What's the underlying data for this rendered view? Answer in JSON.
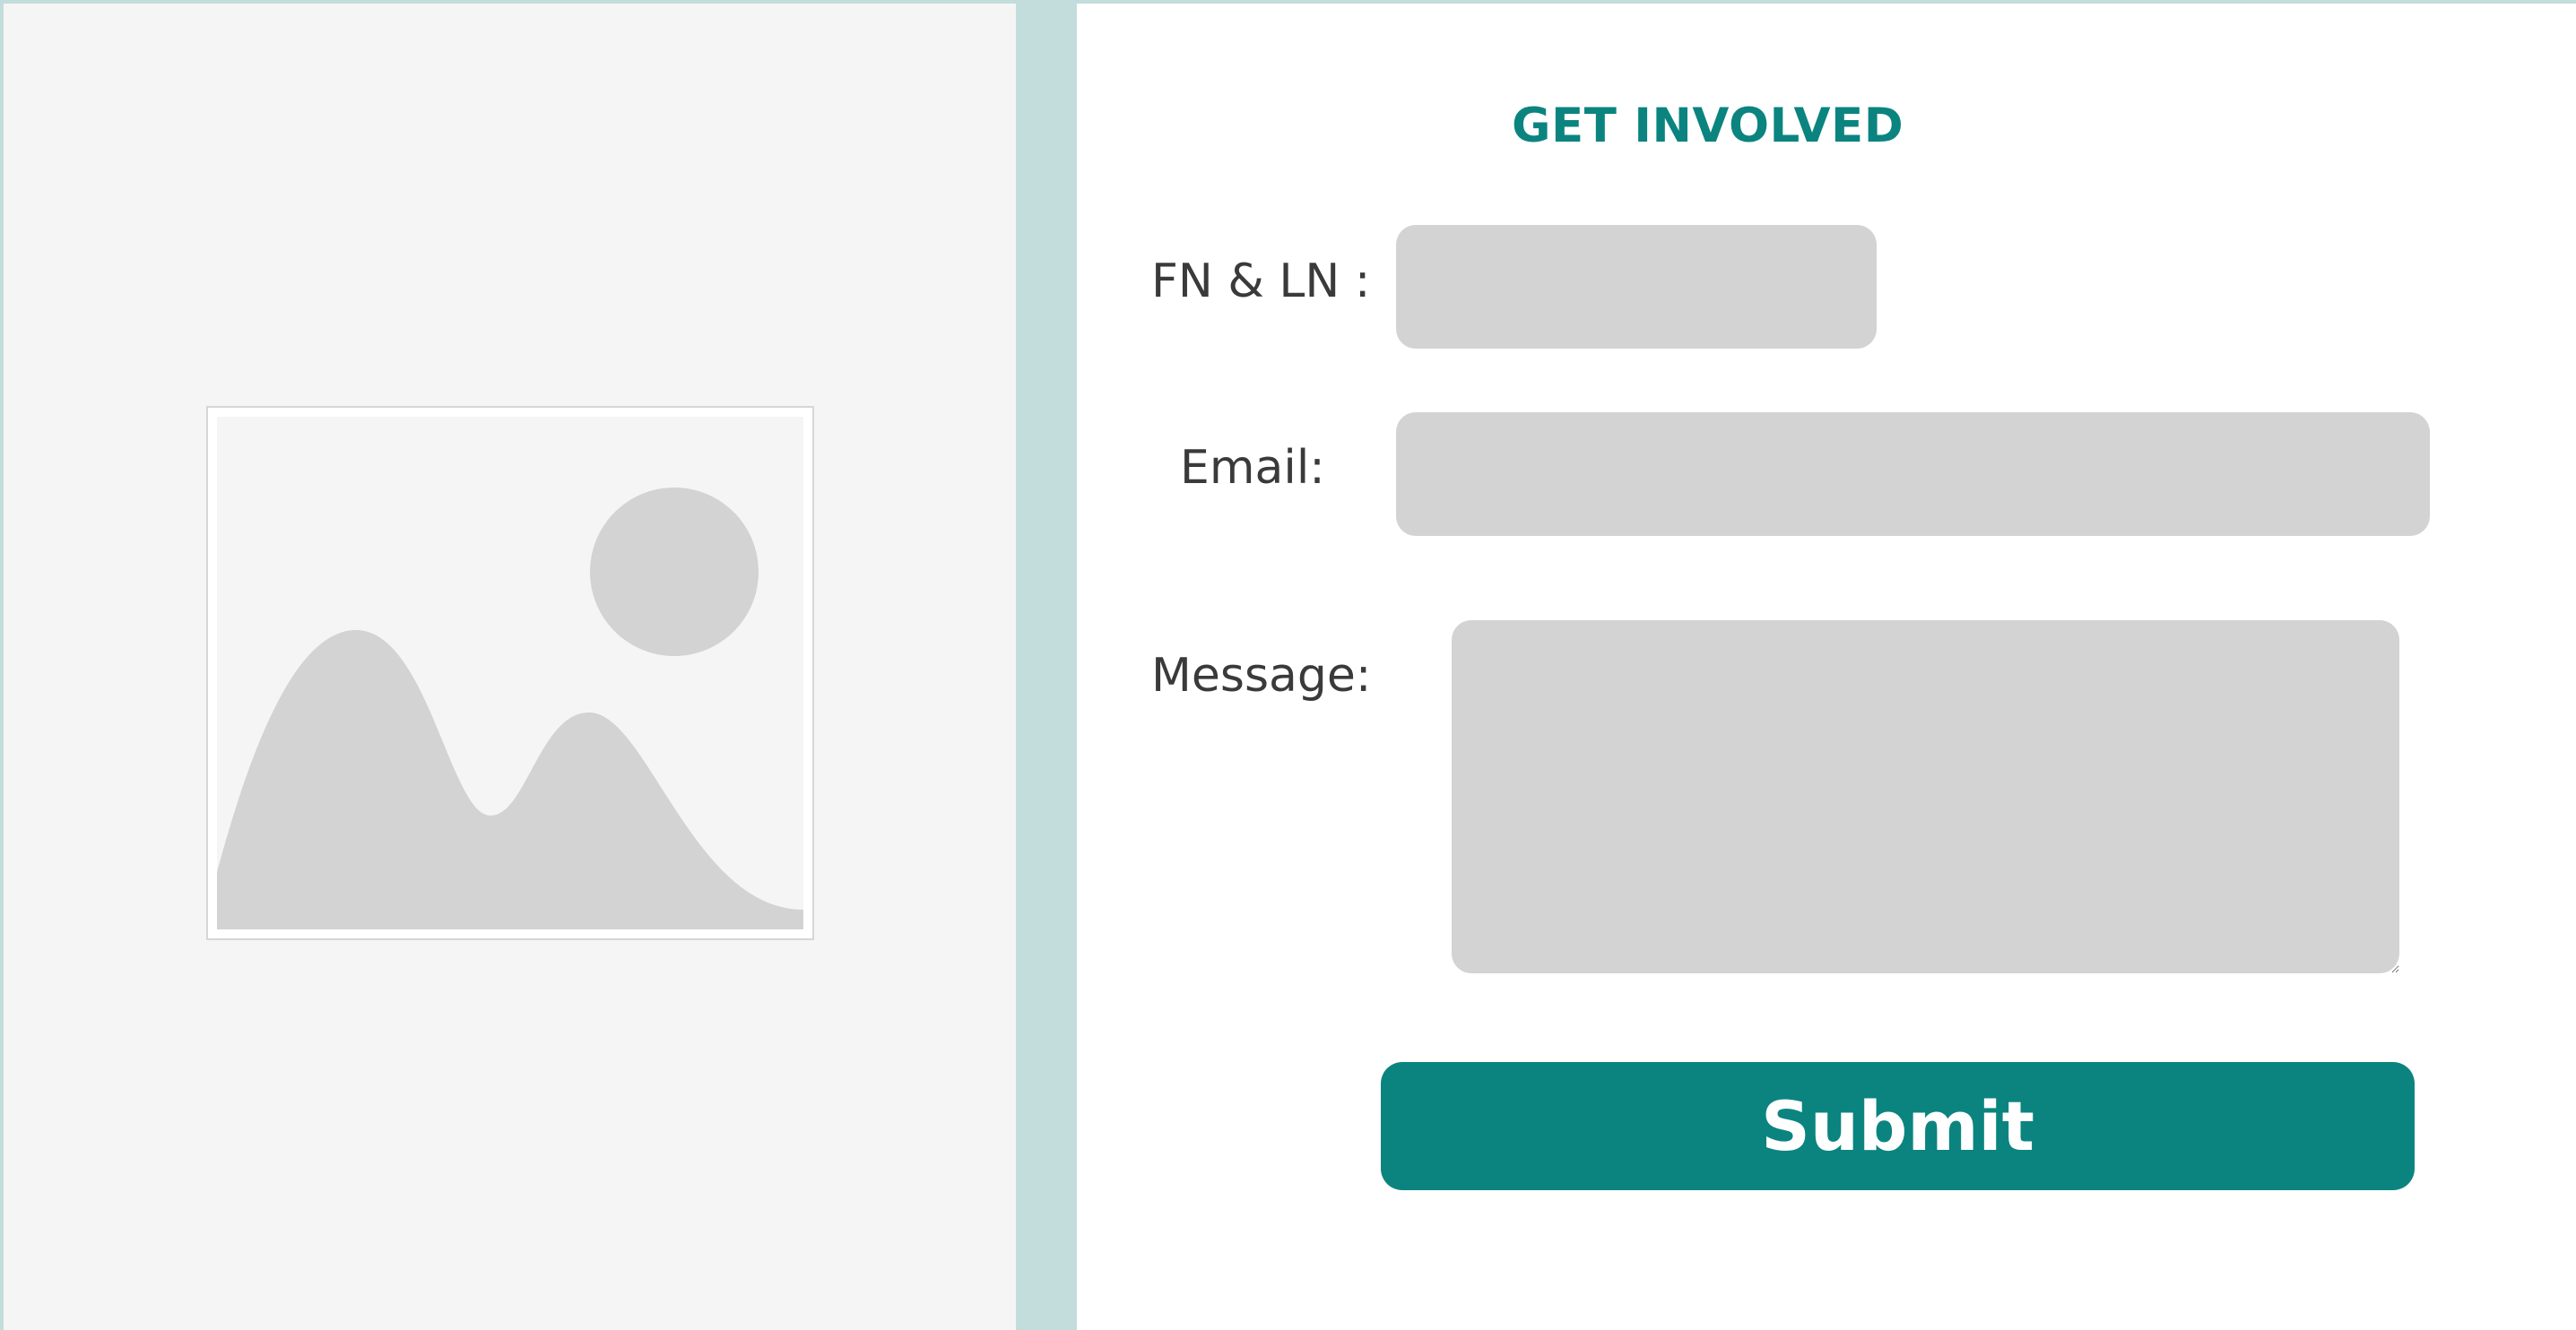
{
  "form": {
    "title": "GET INVOLVED",
    "fields": {
      "name_label": "FN & LN :",
      "name_value": "",
      "email_label": "Email:",
      "email_value": "",
      "message_label": "Message:",
      "message_value": ""
    },
    "submit_label": "Submit"
  },
  "image": {
    "icon": "image-placeholder-icon"
  },
  "colors": {
    "accent": "#0b8480",
    "divider": "#c3dcdc",
    "left_panel_bg": "#f5f5f5",
    "input_bg": "#d2d3d2",
    "placeholder_shape": "#d2d3d2",
    "label_text": "#3a3a3a"
  }
}
